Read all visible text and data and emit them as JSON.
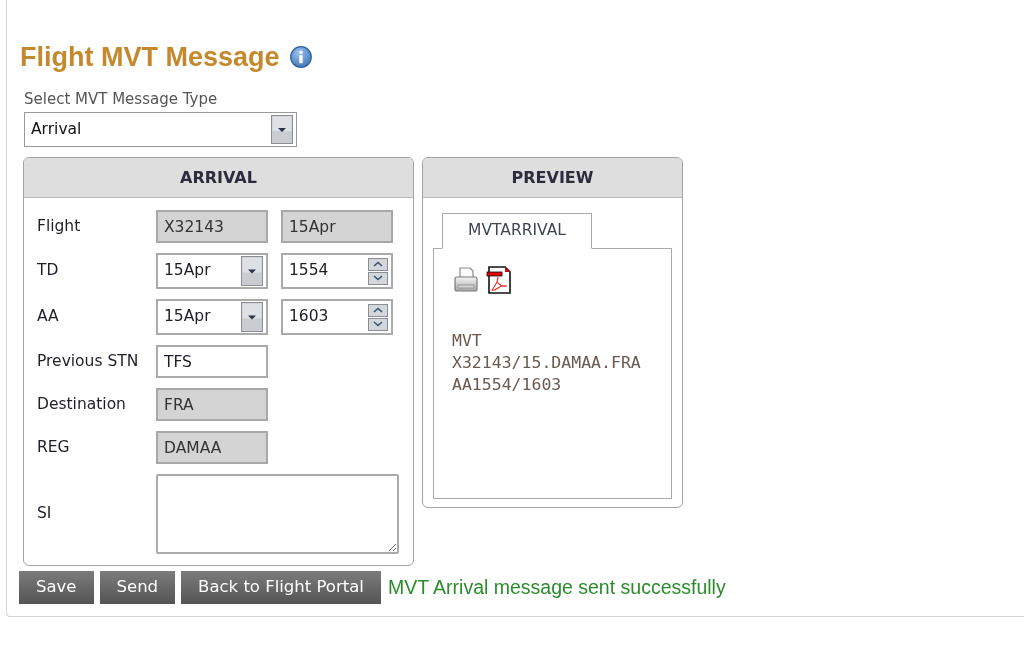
{
  "page": {
    "title": "Flight MVT Message"
  },
  "message_type": {
    "label": "Select MVT Message Type",
    "value": "Arrival"
  },
  "arrival_panel": {
    "heading": "ARRIVAL",
    "rows": [
      {
        "label": "Flight",
        "fields": [
          {
            "kind": "text",
            "value": "X32143",
            "disabled": true
          },
          {
            "kind": "text",
            "value": "15Apr",
            "disabled": true
          }
        ]
      },
      {
        "label": "TD",
        "fields": [
          {
            "kind": "dropdown",
            "value": "15Apr",
            "disabled": false
          },
          {
            "kind": "spinner",
            "value": "1554",
            "disabled": false
          }
        ]
      },
      {
        "label": "AA",
        "fields": [
          {
            "kind": "dropdown",
            "value": "15Apr",
            "disabled": false
          },
          {
            "kind": "spinner",
            "value": "1603",
            "disabled": false
          }
        ]
      },
      {
        "label": "Previous STN",
        "fields": [
          {
            "kind": "text",
            "value": "TFS",
            "disabled": false
          }
        ]
      },
      {
        "label": "Destination",
        "fields": [
          {
            "kind": "text",
            "value": "FRA",
            "disabled": true
          }
        ]
      },
      {
        "label": "REG",
        "fields": [
          {
            "kind": "text",
            "value": "DAMAA",
            "disabled": true
          }
        ]
      },
      {
        "label": "SI",
        "fields": [
          {
            "kind": "textarea",
            "disabled": false
          }
        ]
      }
    ]
  },
  "preview_panel": {
    "heading": "PREVIEW",
    "tabs": [
      {
        "label": "MVTARRIVAL",
        "selected": true
      }
    ],
    "message_lines": [
      "MVT",
      "X32143/15.DAMAA.FRA",
      "AA1554/1603"
    ]
  },
  "buttons": [
    {
      "label": "Save"
    },
    {
      "label": "Send"
    },
    {
      "label": "Back to Flight Portal"
    }
  ],
  "status_message": "MVT Arrival message sent successfully"
}
